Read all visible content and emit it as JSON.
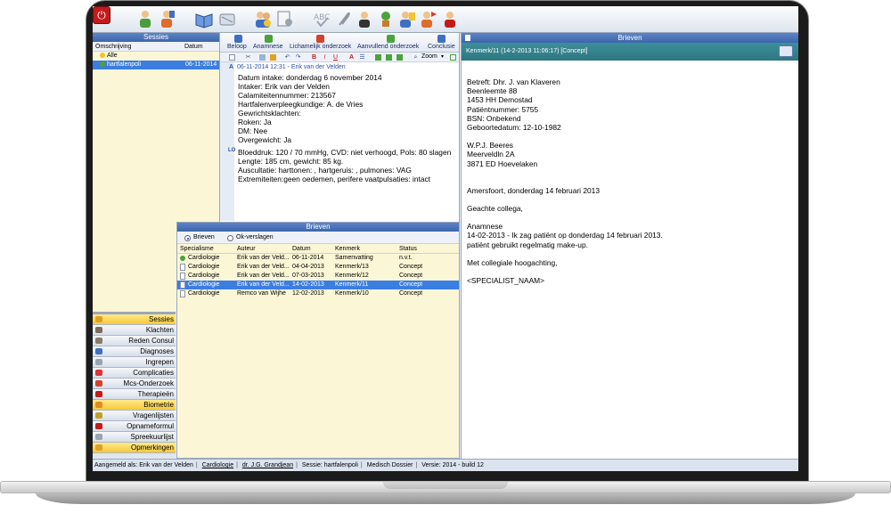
{
  "toolbar": {
    "icons": [
      "power-icon",
      "patient-icon",
      "doctor-icon",
      "book-icon",
      "scissors-icon",
      "team-icon",
      "notes-icon",
      "spellcheck-icon",
      "paperclip-icon",
      "person-icon",
      "plant-icon",
      "user-edit-icon",
      "user-flag-icon",
      "user-heart-icon"
    ]
  },
  "sessies": {
    "title": "Sessies",
    "col_omschrijving": "Omschrijving",
    "col_datum": "Datum",
    "rows": [
      {
        "label": "Alle",
        "date": ""
      },
      {
        "label": "hartfalenpoli",
        "date": "06-11-2014"
      }
    ]
  },
  "nav": {
    "items": [
      "Sessies",
      "Klachten",
      "Reden Consul",
      "Diagnoses",
      "Ingrepen",
      "Complicaties",
      "Mcs-Onderzoek",
      "Therapieën",
      "Biometrie",
      "Vragenlijsten",
      "Opnameformul",
      "Spreekuurlijst",
      "Opmerkingen"
    ]
  },
  "mid": {
    "tabs": [
      "Beloop",
      "Anamnese",
      "Lichamelijk onderzoek",
      "Aanvullend onderzoek",
      "Conclusie"
    ],
    "zoom_label": "Zoom",
    "gutter_a": "A",
    "gutter_lo": "LO",
    "note_header": "06-11-2014 12:31 - Erik van der Velden",
    "lines_a": [
      "Datum intake:  donderdag 6 november 2014",
      "Intaker:  Erik van der Velden",
      "Calamiteitennummer:  213567",
      "Hartfalenverpleegkundige:  A. de Vries",
      "Gewrichtsklachten:",
      "Roken: Ja",
      "DM: Nee",
      "Overgewicht: Ja"
    ],
    "lines_lo": [
      "Bloeddruk: 120 / 70 mmHg, CVD: niet verhoogd, Pols: 80 slagen",
      "Lengte: 185 cm, gewicht: 85 kg.",
      "Auscultatie: harttonen: , hartgeruis: , pulmones: VAG",
      "Extremiteiten:geen oedemen, perifere vaatpulsaties: intact"
    ]
  },
  "brieven": {
    "title": "Brieven",
    "radio_brieven": "Brieven",
    "radio_ok": "Ok-verslagen",
    "headers": [
      "Specialisme",
      "Auteur",
      "Datum",
      "Kenmerk",
      "Status"
    ],
    "rows": [
      [
        "Cardiologie",
        "Erik van der Veld...",
        "06-11-2014",
        "Samenvatting",
        "n.v.t."
      ],
      [
        "Cardiologie",
        "Erik van der Veld...",
        "04-04-2013",
        "Kenmerk/13",
        "Concept"
      ],
      [
        "Cardiologie",
        "Erik van der Veld...",
        "07-03-2013",
        "Kenmerk/12",
        "Concept"
      ],
      [
        "Cardiologie",
        "Erik van der Veld...",
        "14-02-2013",
        "Kenmerk/11",
        "Concept"
      ],
      [
        "Cardiologie",
        "Remco van Wijhe",
        "12-02-2013",
        "Kenmerk/10",
        "Concept"
      ]
    ],
    "selected_index": 3
  },
  "right": {
    "title": "Brieven",
    "subtitle": "Kenmerk/11 (14-2-2013 11:06:17) [Concept]",
    "letter_block1": [
      "Betreft: Dhr. J. van Klaveren",
      "Beenleemte 88",
      "1453 HH Demostad",
      "Patiëntnummer: 5755",
      "BSN: Onbekend",
      "Geboortedatum: 12-10-1982"
    ],
    "letter_block2": [
      "W.P.J. Beeres",
      "Meerveldln 2A",
      "3871 ED Hoevelaken"
    ],
    "place_date": "Amersfoort, donderdag 14 februari 2013",
    "greeting": "Geachte collega,",
    "anamnese_title": "Anamnese",
    "anamnese_lines": [
      "14-02-2013 - Ik zag patiënt op donderdag 14 februari 2013.",
      "patiënt gebruikt regelmatig make-up."
    ],
    "closing": "Met collegiale hoogachting,",
    "signature": "<SPECIALIST_NAAM>"
  },
  "status": {
    "logged_in": "Aangemeld als: Erik van der Velden",
    "specialism": "Cardiologie",
    "doctor": "dr. J.G. Grandjean",
    "session": "Sessie: hartfalenpoli",
    "dossier": "Medisch Dossier",
    "version": "Versie: 2014 - build 12"
  },
  "colors": {
    "title_blue": "#3c66ad",
    "teal": "#2d7780",
    "yellow_panel": "#fbf6d6",
    "selection": "#3c7de0"
  }
}
